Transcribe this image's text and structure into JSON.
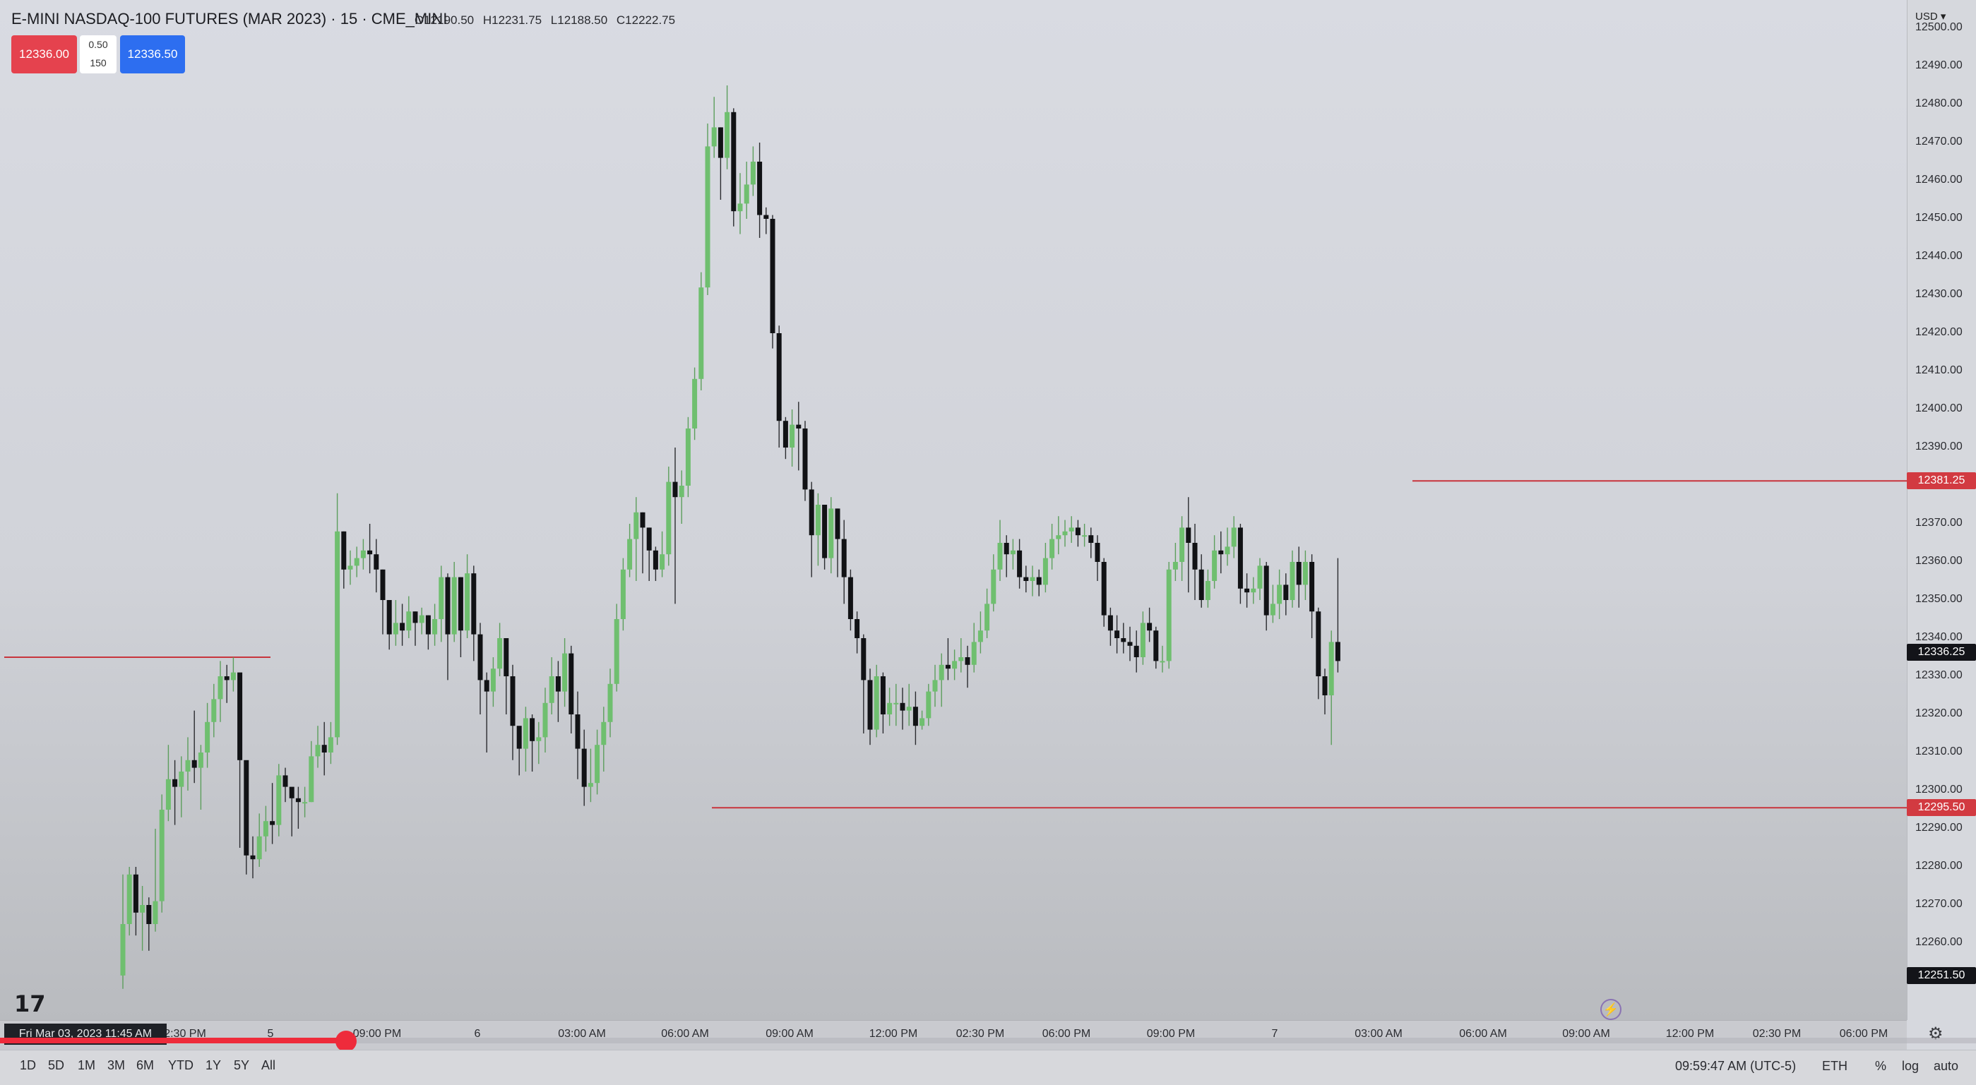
{
  "header": {
    "title": "E-MINI NASDAQ-100 FUTURES (MAR 2023) · 15 · CME_MINI",
    "ohlc": {
      "open": "O12190.50",
      "high": "H12231.75",
      "low": "L12188.50",
      "close": "C12222.75"
    },
    "sell_price": "12336.00",
    "spread": "0.50",
    "quantity": "150",
    "buy_price": "12336.50"
  },
  "price_scale": {
    "currency": "USD ▾",
    "labels": [
      "12500.00",
      "12490.00",
      "12480.00",
      "12470.00",
      "12460.00",
      "12450.00",
      "12440.00",
      "12430.00",
      "12420.00",
      "12410.00",
      "12400.00",
      "12390.00",
      "12370.00",
      "12360.00",
      "12350.00",
      "12340.00",
      "12330.00",
      "12320.00",
      "12310.00",
      "12300.00",
      "12290.00",
      "12280.00",
      "12270.00",
      "12260.00"
    ],
    "tags": [
      {
        "text": "12381.25",
        "color": "#d23a41"
      },
      {
        "text": "12336.25",
        "color": "#131419"
      },
      {
        "text": "12295.50",
        "color": "#d23a41"
      },
      {
        "text": "12251.50",
        "color": "#131419"
      }
    ]
  },
  "time_axis": {
    "labels": [
      "2:30 PM",
      "5",
      "09:00 PM",
      "6",
      "03:00 AM",
      "06:00 AM",
      "09:00 AM",
      "12:00 PM",
      "02:30 PM",
      "06:00 PM",
      "09:00 PM",
      "7",
      "03:00 AM",
      "06:00 AM",
      "09:00 AM",
      "12:00 PM",
      "02:30 PM",
      "06:00 PM"
    ],
    "crosshair_date": "Fri Mar 03, 2023  11:45 AM"
  },
  "bottom_bar": {
    "ranges": [
      "1D",
      "5D",
      "1M",
      "3M",
      "6M",
      "YTD",
      "1Y",
      "5Y",
      "All"
    ],
    "clock": "09:59:47 AM (UTC-5)",
    "session": "ETH",
    "percent": "%",
    "log": "log",
    "auto": "auto"
  },
  "logo_text": "17",
  "video_progress": 0.175,
  "colors": {
    "up": "#6fbf6f",
    "down": "#111215",
    "level_line": "#c8343c"
  },
  "chart_data": {
    "type": "candlestick",
    "title": "E-MINI NASDAQ-100 FUTURES (MAR 2023) · 15 · CME_MINI",
    "ylim": [
      12245,
      12500
    ],
    "horizontal_levels": [
      12381.25,
      12335.0,
      12295.5
    ],
    "candles": [
      [
        12251.5,
        12265.0,
        12278.0,
        12248.0
      ],
      [
        12265.0,
        12278.0,
        12280.0,
        12262.0
      ],
      [
        12278.0,
        12268.0,
        12280.0,
        12262.0
      ],
      [
        12268.0,
        12270.0,
        12275.0,
        12258.0
      ],
      [
        12270.0,
        12265.0,
        12272.0,
        12258.0
      ],
      [
        12265.0,
        12271.0,
        12290.0,
        12263.0
      ],
      [
        12271.0,
        12295.0,
        12299.0,
        12268.0
      ],
      [
        12295.0,
        12303.0,
        12312.0,
        12292.0
      ],
      [
        12303.0,
        12301.0,
        12308.0,
        12291.0
      ],
      [
        12301.0,
        12305.0,
        12309.0,
        12293.0
      ],
      [
        12305.0,
        12308.0,
        12314.0,
        12300.0
      ],
      [
        12308.0,
        12306.0,
        12321.0,
        12302.0
      ],
      [
        12306.0,
        12310.0,
        12312.0,
        12295.0
      ],
      [
        12310.0,
        12318.0,
        12323.0,
        12306.0
      ],
      [
        12318.0,
        12324.0,
        12328.0,
        12314.0
      ],
      [
        12324.0,
        12330.0,
        12334.0,
        12318.0
      ],
      [
        12330.0,
        12329.0,
        12333.0,
        12323.0
      ],
      [
        12329.0,
        12331.0,
        12335.0,
        12326.0
      ],
      [
        12331.0,
        12308.0,
        12312.0,
        12285.0
      ],
      [
        12308.0,
        12283.0,
        12287.0,
        12278.0
      ],
      [
        12283.0,
        12282.0,
        12288.0,
        12277.0
      ],
      [
        12282.0,
        12288.0,
        12294.0,
        12280.0
      ],
      [
        12288.0,
        12292.0,
        12296.0,
        12284.0
      ],
      [
        12292.0,
        12291.0,
        12302.0,
        12286.0
      ],
      [
        12291.0,
        12304.0,
        12307.0,
        12288.0
      ],
      [
        12304.0,
        12301.0,
        12306.0,
        12297.0
      ],
      [
        12301.0,
        12298.0,
        12300.0,
        12288.0
      ],
      [
        12298.0,
        12297.0,
        12301.0,
        12290.0
      ],
      [
        12297.0,
        12297.0,
        12301.0,
        12293.0
      ],
      [
        12297.0,
        12309.0,
        12313.0,
        12297.0
      ],
      [
        12309.0,
        12312.0,
        12317.0,
        12306.0
      ],
      [
        12312.0,
        12310.0,
        12318.0,
        12304.0
      ],
      [
        12310.0,
        12314.0,
        12318.0,
        12307.0
      ],
      [
        12314.0,
        12368.0,
        12378.0,
        12312.0
      ],
      [
        12368.0,
        12358.0,
        12368.0,
        12353.0
      ],
      [
        12358.0,
        12359.0,
        12363.0,
        12354.0
      ],
      [
        12359.0,
        12361.0,
        12364.0,
        12356.0
      ],
      [
        12361.0,
        12363.0,
        12366.0,
        12358.0
      ],
      [
        12363.0,
        12362.0,
        12370.0,
        12357.0
      ],
      [
        12362.0,
        12358.0,
        12366.0,
        12352.0
      ],
      [
        12358.0,
        12350.0,
        12358.0,
        12341.0
      ],
      [
        12350.0,
        12341.0,
        12350.0,
        12337.0
      ],
      [
        12341.0,
        12344.0,
        12350.0,
        12338.0
      ],
      [
        12344.0,
        12342.0,
        12349.0,
        12338.0
      ],
      [
        12342.0,
        12347.0,
        12351.0,
        12340.0
      ],
      [
        12347.0,
        12344.0,
        12347.0,
        12338.0
      ],
      [
        12344.0,
        12346.0,
        12348.0,
        12341.0
      ],
      [
        12346.0,
        12341.0,
        12346.0,
        12337.0
      ],
      [
        12341.0,
        12345.0,
        12349.0,
        12338.0
      ],
      [
        12345.0,
        12356.0,
        12359.0,
        12339.0
      ],
      [
        12356.0,
        12341.0,
        12357.0,
        12329.0
      ],
      [
        12341.0,
        12356.0,
        12360.0,
        12339.0
      ],
      [
        12356.0,
        12342.0,
        12356.0,
        12335.0
      ],
      [
        12342.0,
        12357.0,
        12362.0,
        12340.0
      ],
      [
        12357.0,
        12341.0,
        12359.0,
        12334.0
      ],
      [
        12341.0,
        12329.0,
        12344.0,
        12320.0
      ],
      [
        12329.0,
        12326.0,
        12331.0,
        12310.0
      ],
      [
        12326.0,
        12332.0,
        12335.0,
        12322.0
      ],
      [
        12332.0,
        12340.0,
        12344.0,
        12330.0
      ],
      [
        12340.0,
        12330.0,
        12340.0,
        12320.0
      ],
      [
        12330.0,
        12317.0,
        12333.0,
        12308.0
      ],
      [
        12317.0,
        12311.0,
        12316.0,
        12304.0
      ],
      [
        12311.0,
        12319.0,
        12322.0,
        12305.0
      ],
      [
        12319.0,
        12313.0,
        12320.0,
        12305.0
      ],
      [
        12313.0,
        12314.0,
        12318.0,
        12307.0
      ],
      [
        12314.0,
        12323.0,
        12327.0,
        12310.0
      ],
      [
        12323.0,
        12330.0,
        12335.0,
        12320.0
      ],
      [
        12330.0,
        12326.0,
        12334.0,
        12318.0
      ],
      [
        12326.0,
        12336.0,
        12340.0,
        12322.0
      ],
      [
        12336.0,
        12320.0,
        12338.0,
        12315.0
      ],
      [
        12320.0,
        12311.0,
        12326.0,
        12303.0
      ],
      [
        12311.0,
        12301.0,
        12316.0,
        12296.0
      ],
      [
        12301.0,
        12302.0,
        12311.0,
        12297.0
      ],
      [
        12302.0,
        12312.0,
        12316.0,
        12299.0
      ],
      [
        12312.0,
        12318.0,
        12322.0,
        12305.0
      ],
      [
        12318.0,
        12328.0,
        12332.0,
        12314.0
      ],
      [
        12328.0,
        12345.0,
        12349.0,
        12326.0
      ],
      [
        12345.0,
        12358.0,
        12361.0,
        12342.0
      ],
      [
        12358.0,
        12366.0,
        12370.0,
        12356.0
      ],
      [
        12366.0,
        12373.0,
        12377.0,
        12355.0
      ],
      [
        12373.0,
        12369.0,
        12373.0,
        12357.0
      ],
      [
        12369.0,
        12363.0,
        12369.0,
        12355.0
      ],
      [
        12363.0,
        12358.0,
        12364.0,
        12355.0
      ],
      [
        12358.0,
        12362.0,
        12368.0,
        12356.0
      ],
      [
        12362.0,
        12381.0,
        12385.0,
        12359.0
      ],
      [
        12381.0,
        12377.0,
        12390.0,
        12349.0
      ],
      [
        12377.0,
        12380.0,
        12384.0,
        12370.0
      ],
      [
        12380.0,
        12395.0,
        12398.0,
        12377.0
      ],
      [
        12395.0,
        12408.0,
        12411.0,
        12392.0
      ],
      [
        12408.0,
        12432.0,
        12436.0,
        12405.0
      ],
      [
        12432.0,
        12469.0,
        12475.0,
        12430.0
      ],
      [
        12469.0,
        12474.0,
        12482.0,
        12466.0
      ],
      [
        12474.0,
        12466.0,
        12474.0,
        12455.0
      ],
      [
        12466.0,
        12478.0,
        12485.0,
        12463.0
      ],
      [
        12478.0,
        12452.0,
        12479.0,
        12448.0
      ],
      [
        12452.0,
        12454.0,
        12462.0,
        12446.0
      ],
      [
        12454.0,
        12459.0,
        12465.0,
        12450.0
      ],
      [
        12459.0,
        12465.0,
        12469.0,
        12456.0
      ],
      [
        12465.0,
        12451.0,
        12470.0,
        12445.0
      ],
      [
        12451.0,
        12450.0,
        12453.0,
        12446.0
      ],
      [
        12450.0,
        12420.0,
        12451.0,
        12416.0
      ],
      [
        12420.0,
        12397.0,
        12422.0,
        12390.0
      ],
      [
        12397.0,
        12390.0,
        12398.0,
        12387.0
      ],
      [
        12390.0,
        12396.0,
        12400.0,
        12385.0
      ],
      [
        12396.0,
        12395.0,
        12402.0,
        12384.0
      ],
      [
        12395.0,
        12379.0,
        12397.0,
        12376.0
      ],
      [
        12379.0,
        12367.0,
        12381.0,
        12356.0
      ],
      [
        12367.0,
        12375.0,
        12378.0,
        12359.0
      ],
      [
        12375.0,
        12361.0,
        12375.0,
        12358.0
      ],
      [
        12361.0,
        12374.0,
        12377.0,
        12357.0
      ],
      [
        12374.0,
        12366.0,
        12374.0,
        12356.0
      ],
      [
        12366.0,
        12356.0,
        12371.0,
        12349.0
      ],
      [
        12356.0,
        12345.0,
        12358.0,
        12342.0
      ],
      [
        12345.0,
        12340.0,
        12347.0,
        12336.0
      ],
      [
        12340.0,
        12329.0,
        12341.0,
        12315.0
      ],
      [
        12329.0,
        12316.0,
        12332.0,
        12312.0
      ],
      [
        12316.0,
        12330.0,
        12333.0,
        12314.0
      ],
      [
        12330.0,
        12320.0,
        12331.0,
        12315.0
      ],
      [
        12320.0,
        12323.0,
        12327.0,
        12317.0
      ],
      [
        12323.0,
        12323.0,
        12328.0,
        12317.0
      ],
      [
        12323.0,
        12321.0,
        12327.0,
        12316.0
      ],
      [
        12321.0,
        12322.0,
        12328.0,
        12317.0
      ],
      [
        12322.0,
        12317.0,
        12326.0,
        12312.0
      ],
      [
        12317.0,
        12319.0,
        12321.0,
        12316.0
      ],
      [
        12319.0,
        12326.0,
        12328.0,
        12317.0
      ],
      [
        12326.0,
        12329.0,
        12333.0,
        12322.0
      ],
      [
        12329.0,
        12333.0,
        12336.0,
        12322.0
      ],
      [
        12333.0,
        12332.0,
        12340.0,
        12329.0
      ],
      [
        12332.0,
        12334.0,
        12337.0,
        12329.0
      ],
      [
        12334.0,
        12335.0,
        12340.0,
        12331.0
      ],
      [
        12335.0,
        12333.0,
        12338.0,
        12327.0
      ],
      [
        12333.0,
        12339.0,
        12344.0,
        12331.0
      ],
      [
        12339.0,
        12342.0,
        12347.0,
        12336.0
      ],
      [
        12342.0,
        12349.0,
        12353.0,
        12340.0
      ],
      [
        12349.0,
        12358.0,
        12362.0,
        12347.0
      ],
      [
        12358.0,
        12365.0,
        12371.0,
        12355.0
      ],
      [
        12365.0,
        12362.0,
        12367.0,
        12356.0
      ],
      [
        12362.0,
        12363.0,
        12366.0,
        12358.0
      ],
      [
        12363.0,
        12356.0,
        12366.0,
        12353.0
      ],
      [
        12356.0,
        12355.0,
        12359.0,
        12352.0
      ],
      [
        12355.0,
        12356.0,
        12359.0,
        12351.0
      ],
      [
        12356.0,
        12354.0,
        12358.0,
        12351.0
      ],
      [
        12354.0,
        12361.0,
        12365.0,
        12352.0
      ],
      [
        12361.0,
        12366.0,
        12370.0,
        12358.0
      ],
      [
        12366.0,
        12367.0,
        12372.0,
        12362.0
      ],
      [
        12367.0,
        12368.0,
        12371.0,
        12364.0
      ],
      [
        12368.0,
        12369.0,
        12372.0,
        12365.0
      ],
      [
        12369.0,
        12367.0,
        12371.0,
        12364.0
      ],
      [
        12367.0,
        12367.0,
        12370.0,
        12364.0
      ],
      [
        12367.0,
        12365.0,
        12369.0,
        12361.0
      ],
      [
        12365.0,
        12360.0,
        12367.0,
        12355.0
      ],
      [
        12360.0,
        12346.0,
        12361.0,
        12343.0
      ],
      [
        12346.0,
        12342.0,
        12348.0,
        12338.0
      ],
      [
        12342.0,
        12340.0,
        12346.0,
        12336.0
      ],
      [
        12340.0,
        12339.0,
        12344.0,
        12336.0
      ],
      [
        12339.0,
        12338.0,
        12343.0,
        12334.0
      ],
      [
        12338.0,
        12335.0,
        12342.0,
        12331.0
      ],
      [
        12335.0,
        12344.0,
        12347.0,
        12333.0
      ],
      [
        12344.0,
        12342.0,
        12348.0,
        12339.0
      ],
      [
        12342.0,
        12334.0,
        12343.0,
        12332.0
      ],
      [
        12334.0,
        12334.0,
        12338.0,
        12331.0
      ],
      [
        12334.0,
        12358.0,
        12360.0,
        12332.0
      ],
      [
        12358.0,
        12360.0,
        12365.0,
        12355.0
      ],
      [
        12360.0,
        12369.0,
        12372.0,
        12355.0
      ],
      [
        12369.0,
        12365.0,
        12377.0,
        12352.0
      ],
      [
        12365.0,
        12358.0,
        12370.0,
        12350.0
      ],
      [
        12358.0,
        12350.0,
        12362.0,
        12348.0
      ],
      [
        12350.0,
        12355.0,
        12358.0,
        12348.0
      ],
      [
        12355.0,
        12363.0,
        12367.0,
        12353.0
      ],
      [
        12363.0,
        12362.0,
        12368.0,
        12357.0
      ],
      [
        12362.0,
        12364.0,
        12369.0,
        12359.0
      ],
      [
        12364.0,
        12369.0,
        12372.0,
        12361.0
      ],
      [
        12369.0,
        12353.0,
        12370.0,
        12349.0
      ],
      [
        12353.0,
        12352.0,
        12357.0,
        12348.0
      ],
      [
        12352.0,
        12353.0,
        12356.0,
        12349.0
      ],
      [
        12353.0,
        12359.0,
        12361.0,
        12350.0
      ],
      [
        12359.0,
        12346.0,
        12360.0,
        12342.0
      ],
      [
        12346.0,
        12349.0,
        12354.0,
        12344.0
      ],
      [
        12349.0,
        12354.0,
        12358.0,
        12345.0
      ],
      [
        12354.0,
        12350.0,
        12357.0,
        12346.0
      ],
      [
        12350.0,
        12360.0,
        12363.0,
        12348.0
      ],
      [
        12360.0,
        12354.0,
        12364.0,
        12348.0
      ],
      [
        12354.0,
        12360.0,
        12363.0,
        12350.0
      ],
      [
        12360.0,
        12347.0,
        12362.0,
        12340.0
      ],
      [
        12347.0,
        12330.0,
        12348.0,
        12324.0
      ],
      [
        12330.0,
        12325.0,
        12332.0,
        12320.0
      ],
      [
        12325.0,
        12339.0,
        12342.0,
        12312.0
      ],
      [
        12339.0,
        12334.0,
        12361.0,
        12331.0
      ]
    ]
  }
}
